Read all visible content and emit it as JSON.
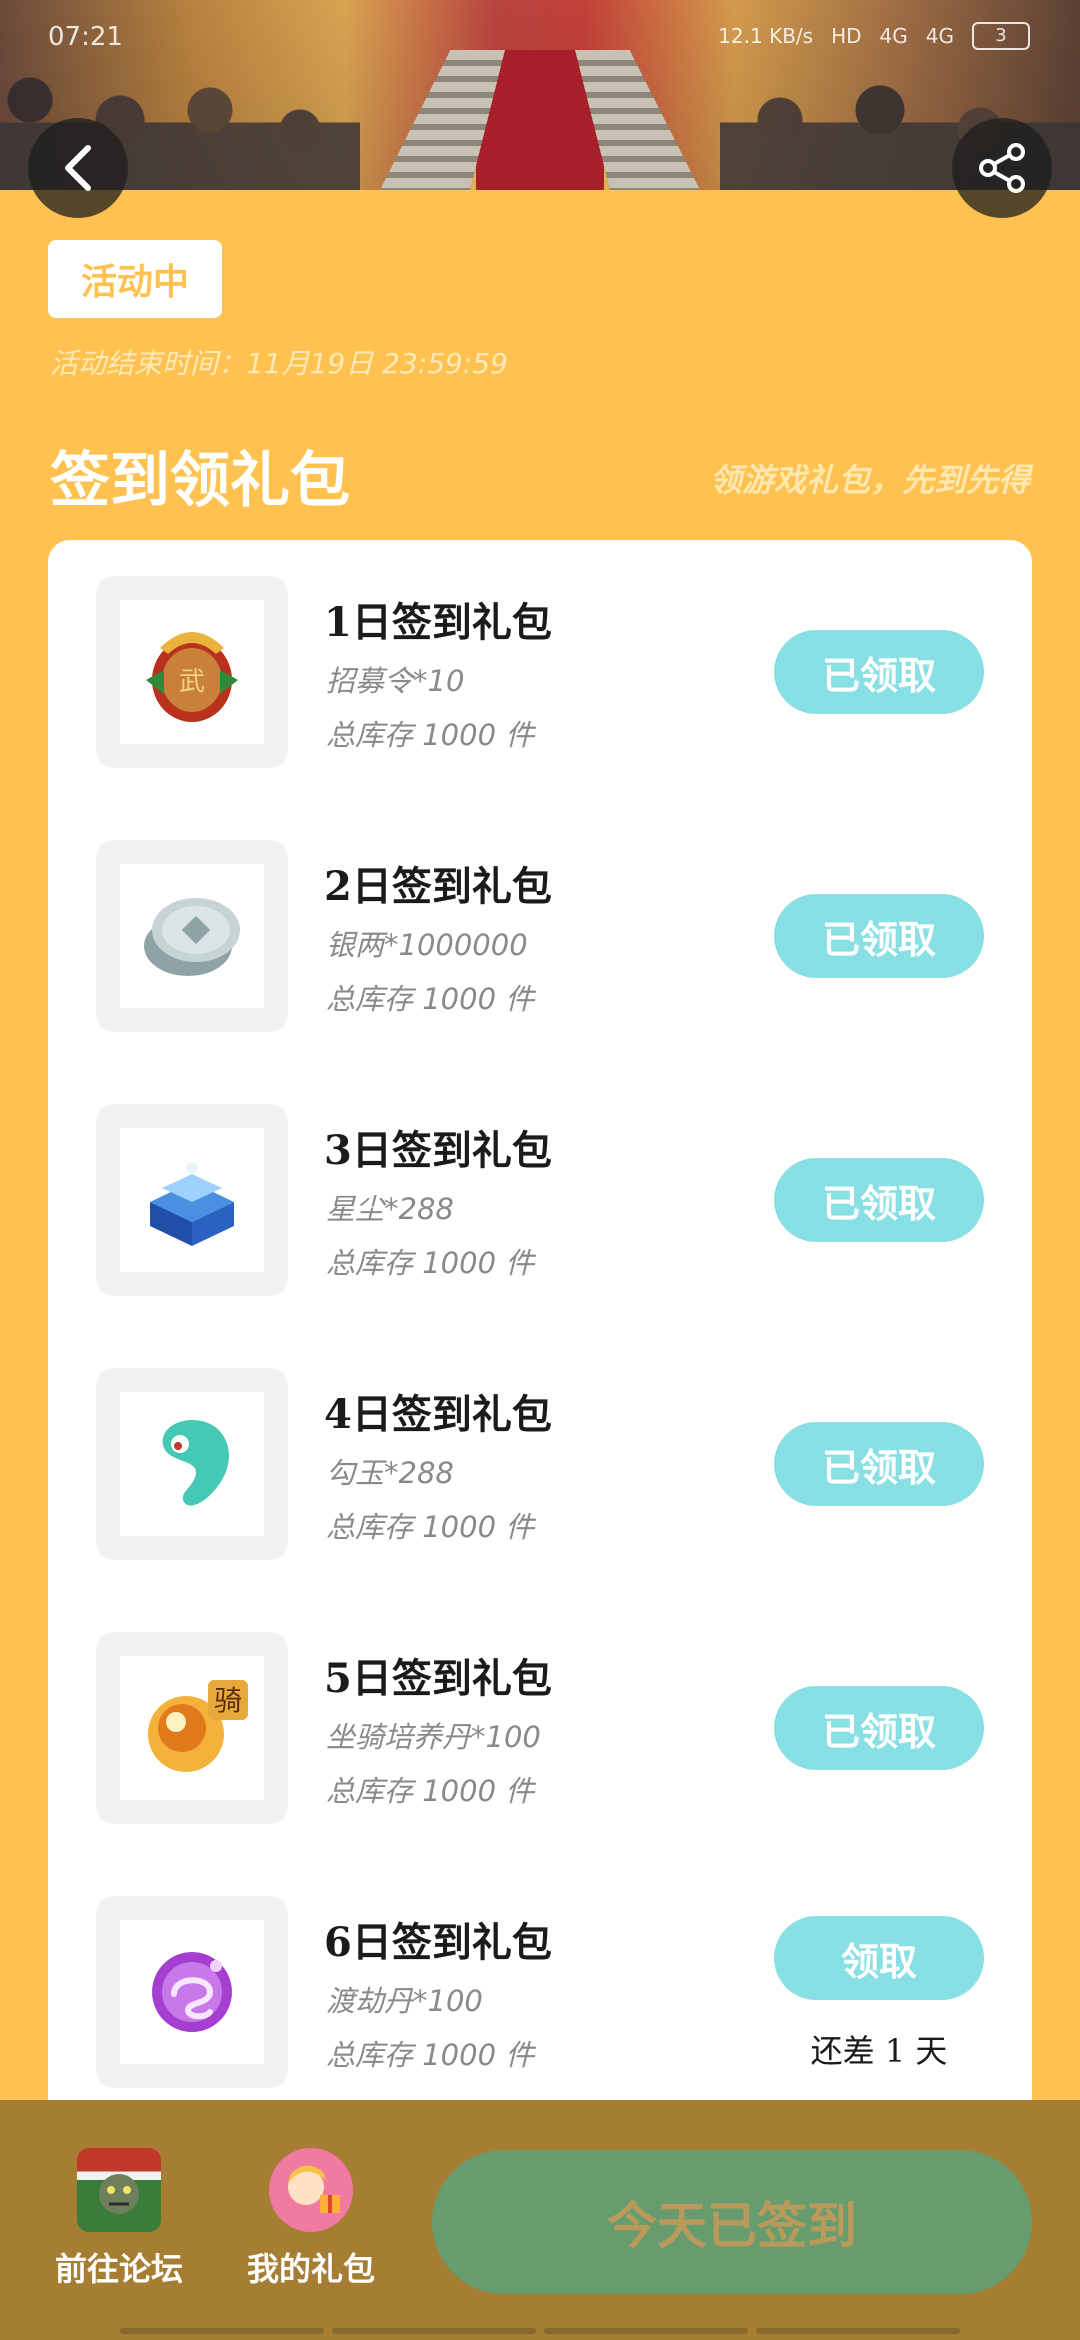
{
  "status_bar": {
    "time": "07:21",
    "net_speed": "12.1 KB/s",
    "hd": "HD",
    "signal_1": "4G",
    "signal_2": "4G",
    "battery": "3"
  },
  "header": {
    "back_icon": "chevron-left-icon",
    "share_icon": "share-icon"
  },
  "activity": {
    "status_label": "活动中",
    "end_time": "活动结束时间：11月19日 23:59:59"
  },
  "section": {
    "title": "签到领礼包",
    "subtitle": "领游戏礼包，先到先得"
  },
  "gifts": [
    {
      "title": "1日签到礼包",
      "reward": "招募令*10",
      "stock": "总库存 1000 件",
      "button": "已领取",
      "icon": "recruit-token-icon",
      "state": "claimed"
    },
    {
      "title": "2日签到礼包",
      "reward": "银两*1000000",
      "stock": "总库存 1000 件",
      "button": "已领取",
      "icon": "silver-coin-icon",
      "state": "claimed"
    },
    {
      "title": "3日签到礼包",
      "reward": "星尘*288",
      "stock": "总库存 1000 件",
      "button": "已领取",
      "icon": "stardust-chest-icon",
      "state": "claimed"
    },
    {
      "title": "4日签到礼包",
      "reward": "勾玉*288",
      "stock": "总库存 1000 件",
      "button": "已领取",
      "icon": "magatama-icon",
      "state": "claimed"
    },
    {
      "title": "5日签到礼包",
      "reward": "坐骑培养丹*100",
      "stock": "总库存 1000 件",
      "button": "已领取",
      "icon": "mount-pill-icon",
      "state": "claimed"
    },
    {
      "title": "6日签到礼包",
      "reward": "渡劫丹*100",
      "stock": "总库存 1000 件",
      "button": "领取",
      "icon": "tribulation-pill-icon",
      "state": "pending",
      "remain": "还差 1 天"
    }
  ],
  "bottom": {
    "forum_label": "前往论坛",
    "gift_label": "我的礼包",
    "signed_label": "今天已签到",
    "mount_badge": "骑"
  },
  "colors": {
    "background": "#FFC250",
    "claim_button": "#89E0E4",
    "bottom_bar": "#A67E33",
    "signed_button": "#679C6E"
  }
}
